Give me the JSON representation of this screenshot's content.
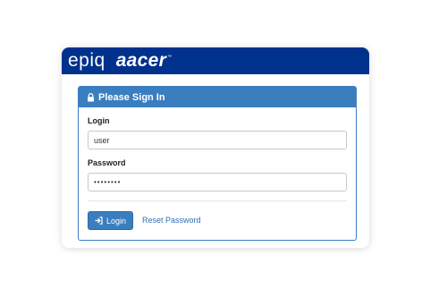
{
  "brand": {
    "logo_primary": "epiq",
    "logo_secondary": "aacer",
    "trademark": "™",
    "bar_color": "#00318c"
  },
  "panel": {
    "heading": "Please Sign In",
    "heading_icon": "lock-icon",
    "accent_color": "#3a7ec0"
  },
  "form": {
    "login_label": "Login",
    "login_value": "user",
    "password_label": "Password",
    "password_value": "••••••••",
    "login_button_label": "Login",
    "login_button_icon": "sign-in-icon",
    "reset_link_label": "Reset Password"
  }
}
